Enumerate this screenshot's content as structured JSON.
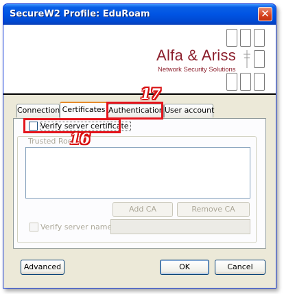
{
  "window": {
    "title": "SecureW2 Profile: EduRoam",
    "close_glyph": "✕"
  },
  "banner": {
    "logo_title": "Alfa & Ariss",
    "logo_subtitle": "Network Security Solutions"
  },
  "tabs": [
    {
      "label": "Connection",
      "active": false
    },
    {
      "label": "Certificates",
      "active": true
    },
    {
      "label": "Authentication",
      "active": false
    },
    {
      "label": "User account",
      "active": false
    }
  ],
  "certificates": {
    "verify_server_certificate": {
      "label": "Verify server certificate",
      "checked": false
    },
    "trusted_root_label": "Trusted Roo",
    "add_ca_label": "Add CA",
    "remove_ca_label": "Remove CA",
    "verify_server_name": {
      "label": "Verify server name:",
      "checked": false,
      "value": ""
    }
  },
  "footer": {
    "advanced_label": "Advanced",
    "ok_label": "OK",
    "cancel_label": "Cancel"
  },
  "annotations": [
    {
      "number": "17"
    },
    {
      "number": "16"
    }
  ],
  "colors": {
    "title_bar": "#0054e3",
    "brand": "#8c1f2c",
    "highlight": "#e4141b"
  }
}
